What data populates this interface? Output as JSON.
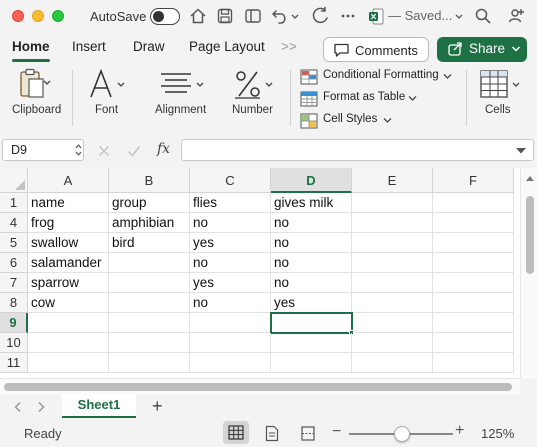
{
  "titlebar": {
    "autosave_label": "AutoSave",
    "saved_label": "— Saved...",
    "icons": [
      "home-icon",
      "save-icon",
      "undo-icon",
      "redo-icon",
      "excel-doc-icon",
      "search-icon",
      "share-people-icon"
    ]
  },
  "tabs": {
    "items": [
      {
        "label": "Home"
      },
      {
        "label": "Insert"
      },
      {
        "label": "Draw"
      },
      {
        "label": "Page Layout"
      },
      {
        "label": ">>"
      }
    ],
    "active": "Home",
    "comments_label": "Comments",
    "share_label": "Share"
  },
  "ribbon": {
    "clipboard": "Clipboard",
    "font": "Font",
    "alignment": "Alignment",
    "number": "Number",
    "conditional_formatting": "Conditional Formatting",
    "format_as_table": "Format as Table",
    "cell_styles": "Cell Styles",
    "cells": "Cells"
  },
  "formula_bar": {
    "name_box": "D9",
    "fx_label": "fx",
    "value": ""
  },
  "grid": {
    "columns": [
      "A",
      "B",
      "C",
      "D",
      "E",
      "F"
    ],
    "selected_column": "D",
    "selected_row": "9",
    "rows": [
      {
        "num": "1",
        "cells": [
          "name",
          "group",
          "flies",
          "gives milk",
          "",
          ""
        ]
      },
      {
        "num": "4",
        "cells": [
          "frog",
          "amphibian",
          "no",
          "no",
          "",
          ""
        ]
      },
      {
        "num": "5",
        "cells": [
          "swallow",
          "bird",
          "yes",
          "no",
          "",
          ""
        ]
      },
      {
        "num": "6",
        "cells": [
          "salamander",
          "",
          "no",
          "no",
          "",
          ""
        ]
      },
      {
        "num": "7",
        "cells": [
          "sparrow",
          "",
          "yes",
          "no",
          "",
          ""
        ]
      },
      {
        "num": "8",
        "cells": [
          "cow",
          "",
          "no",
          "yes",
          "",
          ""
        ]
      },
      {
        "num": "9",
        "cells": [
          "",
          "",
          "",
          "",
          "",
          ""
        ]
      },
      {
        "num": "10",
        "cells": [
          "",
          "",
          "",
          "",
          "",
          ""
        ]
      },
      {
        "num": "11",
        "cells": [
          "",
          "",
          "",
          "",
          "",
          ""
        ]
      }
    ]
  },
  "sheets": {
    "tabs": [
      {
        "label": "Sheet1"
      }
    ],
    "add_label": "+"
  },
  "status": {
    "ready": "Ready",
    "zoom": "125%",
    "zoom_minus": "−",
    "zoom_plus": "+"
  },
  "colors": {
    "accent": "#1e7145",
    "close": "#fe5f57",
    "minimize": "#febc2e",
    "maximize": "#28c840"
  }
}
